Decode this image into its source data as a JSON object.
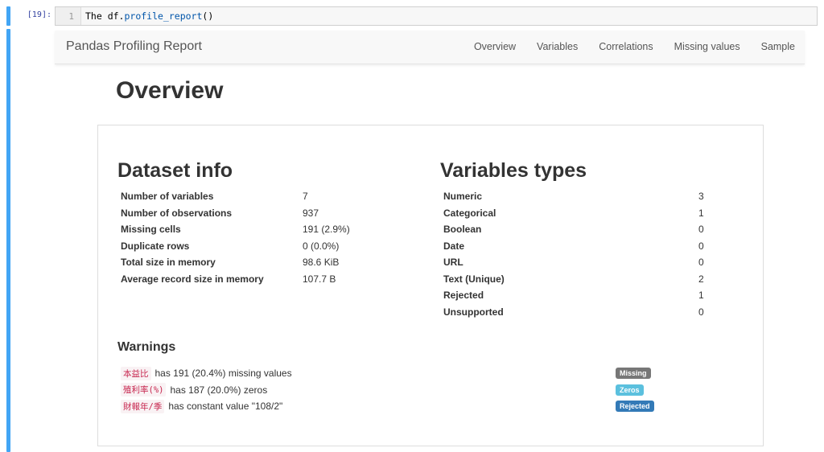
{
  "cell": {
    "prompt": "[19]:",
    "line_number": "1",
    "code_prefix": "The df.",
    "code_func": "profile_report",
    "code_suffix": "()"
  },
  "navbar": {
    "brand": "Pandas Profiling Report",
    "links": [
      "Overview",
      "Variables",
      "Correlations",
      "Missing values",
      "Sample"
    ]
  },
  "page_title": "Overview",
  "dataset_info": {
    "title": "Dataset info",
    "rows": [
      {
        "label": "Number of variables",
        "value": "7"
      },
      {
        "label": "Number of observations",
        "value": "937"
      },
      {
        "label": "Missing cells",
        "value": "191 (2.9%)"
      },
      {
        "label": "Duplicate rows",
        "value": "0 (0.0%)"
      },
      {
        "label": "Total size in memory",
        "value": "98.6 KiB"
      },
      {
        "label": "Average record size in memory",
        "value": "107.7 B"
      }
    ]
  },
  "variables_types": {
    "title": "Variables types",
    "rows": [
      {
        "label": "Numeric",
        "value": "3"
      },
      {
        "label": "Categorical",
        "value": "1"
      },
      {
        "label": "Boolean",
        "value": "0"
      },
      {
        "label": "Date",
        "value": "0"
      },
      {
        "label": "URL",
        "value": "0"
      },
      {
        "label": "Text (Unique)",
        "value": "2"
      },
      {
        "label": "Rejected",
        "value": "1"
      },
      {
        "label": "Unsupported",
        "value": "0"
      }
    ]
  },
  "warnings": {
    "title": "Warnings",
    "items": [
      {
        "var": "本益比",
        "text": "has 191 (20.4%) missing values",
        "badge": "Missing",
        "badge_color": "#777777"
      },
      {
        "var": "殖利率(%)",
        "text": "has 187 (20.0%) zeros",
        "badge": "Zeros",
        "badge_color": "#5bc0de"
      },
      {
        "var": "財報年/季",
        "text": "has constant value \"108/2\"",
        "badge": "Rejected",
        "badge_color": "#337ab7"
      }
    ]
  },
  "colors": {
    "cell_bar": "#42a5f5",
    "var_code": "#c7254e"
  }
}
